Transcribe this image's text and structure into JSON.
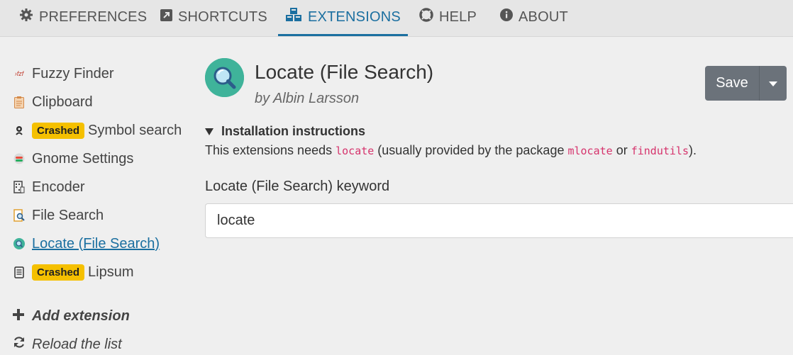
{
  "nav": {
    "tabs": [
      {
        "label": "PREFERENCES",
        "icon": "gear-icon"
      },
      {
        "label": "SHORTCUTS",
        "icon": "external-link-icon"
      },
      {
        "label": "EXTENSIONS",
        "icon": "cubes-icon",
        "active": true
      },
      {
        "label": "HELP",
        "icon": "lifebuoy-icon"
      },
      {
        "label": "ABOUT",
        "icon": "info-icon"
      }
    ]
  },
  "sidebar": {
    "items": [
      {
        "label": "Fuzzy Finder",
        "icon": "fzf-icon",
        "icon_text": "›fzf"
      },
      {
        "label": "Clipboard",
        "icon": "clipboard-icon"
      },
      {
        "label": "Symbol search",
        "icon": "symbol-search-icon",
        "badge": "Crashed"
      },
      {
        "label": "Gnome Settings",
        "icon": "gnome-settings-icon"
      },
      {
        "label": "Encoder",
        "icon": "encoder-icon"
      },
      {
        "label": "File Search",
        "icon": "file-search-icon"
      },
      {
        "label": "Locate (File Search)",
        "icon": "locate-icon",
        "active": true
      },
      {
        "label": "Lipsum",
        "icon": "lipsum-icon",
        "badge": "Crashed"
      }
    ],
    "actions": {
      "add": "Add extension",
      "reload": "Reload the list"
    }
  },
  "extension": {
    "title": "Locate (File Search)",
    "author": "by Albin Larsson",
    "save_label": "Save",
    "install_heading": "Installation instructions",
    "install_text": {
      "part1": "This extensions needs ",
      "code1": "locate",
      "part2": " (usually provided by the package ",
      "code2": "mlocate",
      "part3": " or ",
      "code3": "findutils",
      "part4": ")."
    },
    "keyword_label": "Locate (File Search) keyword",
    "keyword_value": "locate"
  },
  "colors": {
    "accent": "#1b6fa0",
    "badge": "#f5c000",
    "button": "#6b727a",
    "logo": "#3fb39a"
  }
}
